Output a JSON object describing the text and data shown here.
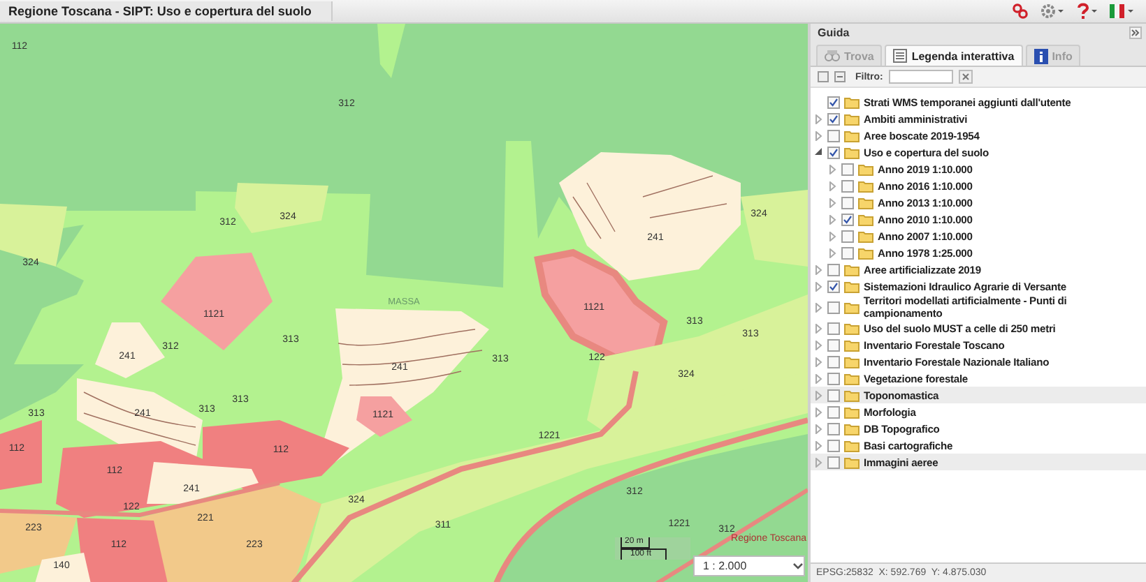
{
  "window": {
    "title": "Regione Toscana - SIPT: Uso e copertura del suolo"
  },
  "panel": {
    "title": "Guida",
    "tabs": [
      {
        "label": "Trova",
        "selected": false
      },
      {
        "label": "Legenda interattiva",
        "selected": true
      },
      {
        "label": "Info",
        "selected": false
      }
    ],
    "filter": {
      "label": "Filtro:"
    },
    "tree": [
      {
        "label": "Strati WMS temporanei aggiunti dall'utente",
        "kind": "leaf",
        "checked": true,
        "shaded": false
      },
      {
        "label": "Ambiti amministrativi",
        "kind": "group",
        "expanded": false,
        "checked": true,
        "shaded": false
      },
      {
        "label": "Aree boscate 2019-1954",
        "kind": "group",
        "expanded": false,
        "checked": false,
        "shaded": false
      },
      {
        "label": "Uso e copertura del suolo",
        "kind": "group",
        "expanded": true,
        "checked": true,
        "shaded": false,
        "children": [
          {
            "label": "Anno 2019 1:10.000",
            "kind": "group",
            "expanded": false,
            "checked": false,
            "shaded": false
          },
          {
            "label": "Anno 2016 1:10.000",
            "kind": "group",
            "expanded": false,
            "checked": false,
            "shaded": false
          },
          {
            "label": "Anno 2013 1:10.000",
            "kind": "group",
            "expanded": false,
            "checked": false,
            "shaded": false
          },
          {
            "label": "Anno 2010 1:10.000",
            "kind": "group",
            "expanded": false,
            "checked": true,
            "shaded": false
          },
          {
            "label": "Anno 2007 1:10.000",
            "kind": "group",
            "expanded": false,
            "checked": false,
            "shaded": false
          },
          {
            "label": "Anno 1978 1:25.000",
            "kind": "group",
            "expanded": false,
            "checked": false,
            "shaded": false
          }
        ]
      },
      {
        "label": "Aree artificializzate 2019",
        "kind": "group",
        "expanded": false,
        "checked": false,
        "shaded": false
      },
      {
        "label": "Sistemazioni Idraulico Agrarie di Versante",
        "kind": "group",
        "expanded": false,
        "checked": true,
        "shaded": false
      },
      {
        "label": "Territori modellati artificialmente - Punti di campionamento",
        "kind": "group",
        "expanded": false,
        "checked": false,
        "shaded": false
      },
      {
        "label": "Uso del suolo MUST a celle di 250 metri",
        "kind": "group",
        "expanded": false,
        "checked": false,
        "shaded": false
      },
      {
        "label": "Inventario Forestale Toscano",
        "kind": "group",
        "expanded": false,
        "checked": false,
        "shaded": false
      },
      {
        "label": "Inventario Forestale Nazionale Italiano",
        "kind": "group",
        "expanded": false,
        "checked": false,
        "shaded": false
      },
      {
        "label": "Vegetazione forestale",
        "kind": "group",
        "expanded": false,
        "checked": false,
        "shaded": false
      },
      {
        "label": "Toponomastica",
        "kind": "group",
        "expanded": false,
        "checked": false,
        "shaded": true
      },
      {
        "label": "Morfologia",
        "kind": "group",
        "expanded": false,
        "checked": false,
        "shaded": false
      },
      {
        "label": "DB Topografico",
        "kind": "group",
        "expanded": false,
        "checked": false,
        "shaded": false
      },
      {
        "label": "Basi cartografiche",
        "kind": "group",
        "expanded": false,
        "checked": false,
        "shaded": false
      },
      {
        "label": "Immagini aeree",
        "kind": "group",
        "expanded": false,
        "checked": false,
        "shaded": true
      }
    ],
    "status": "EPSG:25832  X: 592.769  Y: 4.875.030"
  },
  "map": {
    "labels": [
      "112",
      "312",
      "312",
      "324",
      "324",
      "1121",
      "312",
      "241",
      "313",
      "241",
      "313",
      "MASSA",
      "241",
      "313",
      "313",
      "313",
      "1121",
      "112",
      "112",
      "241",
      "112",
      "122",
      "221",
      "223",
      "223",
      "112",
      "140",
      "324",
      "311",
      "1121",
      "122",
      "313",
      "313",
      "324",
      "241",
      "324",
      "1221",
      "312",
      "1221",
      "312"
    ],
    "credit": "Regione Toscana",
    "scalebar": {
      "top": "20 m",
      "bottom": "100 ft"
    },
    "scale": "1 : 2.000"
  }
}
